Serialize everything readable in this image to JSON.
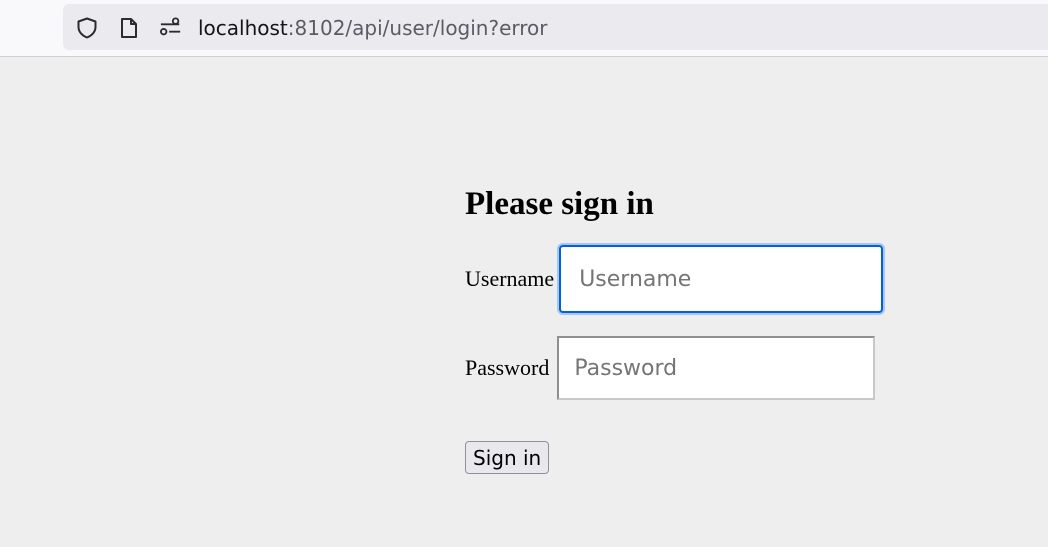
{
  "browser": {
    "url_host": "localhost",
    "url_rest": ":8102/api/user/login?error",
    "icons": [
      "shield-icon",
      "page-icon",
      "permissions-icon"
    ]
  },
  "form": {
    "title": "Please sign in",
    "username_label": "Username",
    "username_placeholder": "Username",
    "username_value": "",
    "password_label": "Password",
    "password_placeholder": "Password",
    "password_value": "",
    "submit_label": "Sign in"
  },
  "colors": {
    "page_bg": "#eeeeee",
    "focus_border": "#0060df"
  }
}
